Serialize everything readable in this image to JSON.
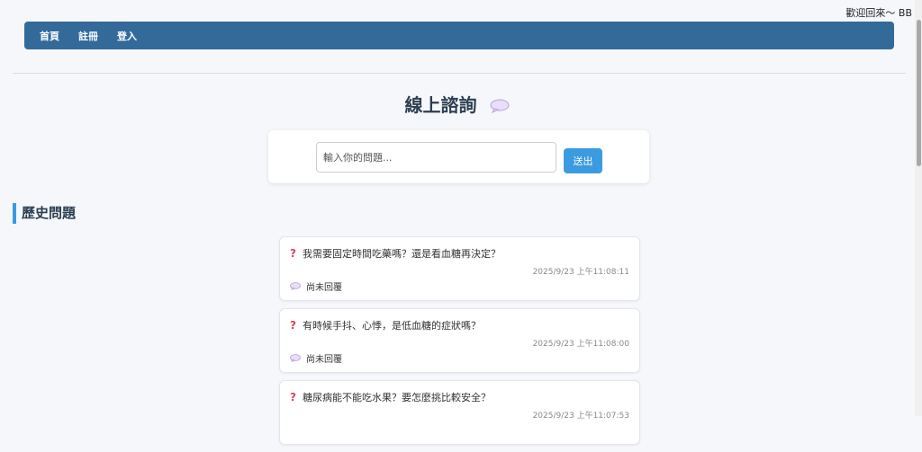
{
  "header": {
    "welcome": "歡迎回來～ BB"
  },
  "nav": {
    "items": [
      {
        "label": "首頁"
      },
      {
        "label": "註冊"
      },
      {
        "label": "登入"
      }
    ]
  },
  "page": {
    "title": "線上諮詢"
  },
  "form": {
    "placeholder": "輸入你的問題...",
    "submit_label": "送出"
  },
  "history": {
    "title": "歷史問題",
    "items": [
      {
        "question": "我需要固定時間吃藥嗎？還是看血糖再決定？",
        "time": "2025/9/23 上午11:08:11",
        "answer": "尚未回覆"
      },
      {
        "question": "有時候手抖、心悸，是低血糖的症狀嗎？",
        "time": "2025/9/23 上午11:08:00",
        "answer": "尚未回覆"
      },
      {
        "question": "糖尿病能不能吃水果？要怎麼挑比較安全？",
        "time": "2025/9/23 上午11:07:53",
        "answer": ""
      }
    ]
  },
  "icons": {
    "title_icon": "speech-bubble-icon",
    "question_icon": "question-mark-icon",
    "answer_icon": "speech-bubble-icon"
  },
  "colors": {
    "nav_bg": "#336a9a",
    "accent": "#3b9be0",
    "question_mark": "#e0415a"
  }
}
